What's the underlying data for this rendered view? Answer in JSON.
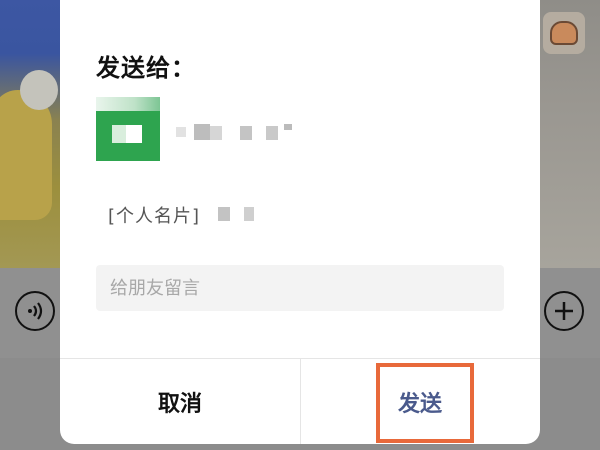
{
  "dialog": {
    "title": "发送给：",
    "card_line": "[个人名片]",
    "message_input": {
      "value": "",
      "placeholder": "给朋友留言"
    },
    "cancel_label": "取消",
    "send_label": "发送"
  },
  "icons": {
    "voice": "voice-input-icon",
    "plus": "plus-icon",
    "sticker": "sticker-icon"
  },
  "colors": {
    "avatar_green": "#2ea44f",
    "send_text": "#4a5a8c",
    "highlight_box": "#e8693a",
    "input_bg": "#f3f3f3"
  }
}
